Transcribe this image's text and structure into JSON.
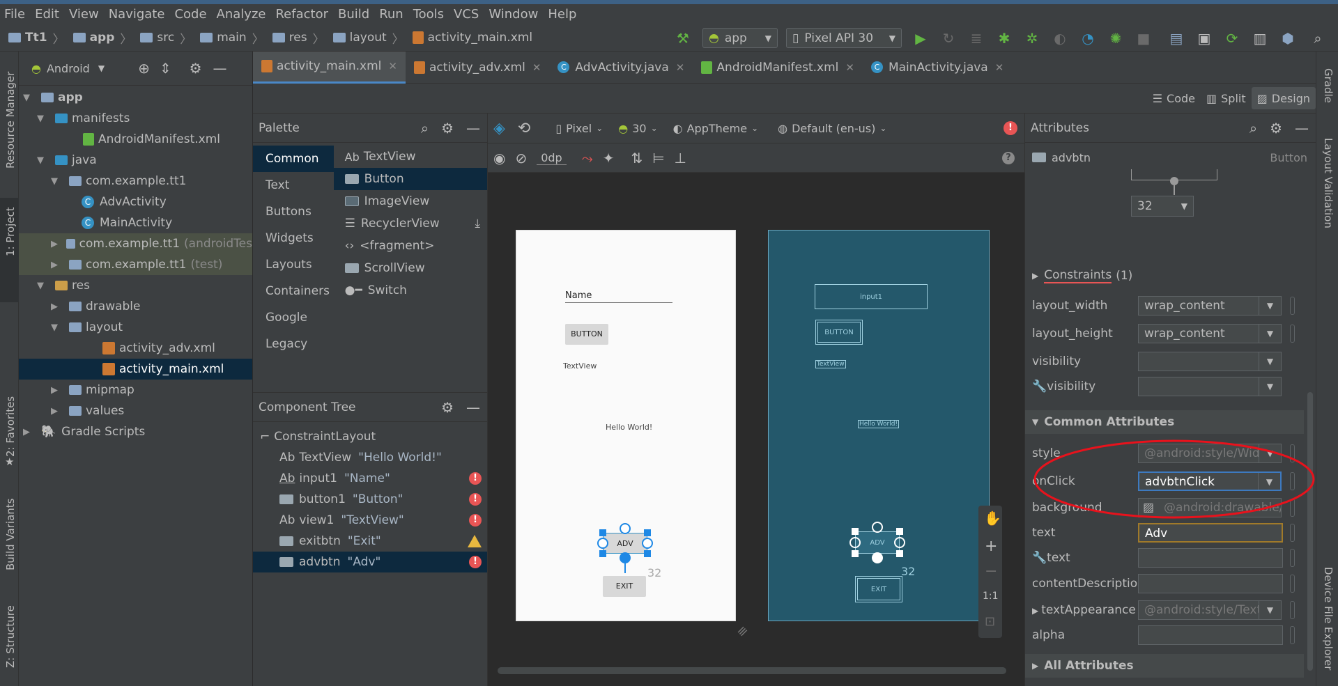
{
  "colors": {
    "accent": "#4a88c7",
    "error": "#e85555",
    "warning": "#e8b83f",
    "blueprint": "#24586b",
    "annotation": "#e8121c"
  },
  "menu": [
    "File",
    "Edit",
    "View",
    "Navigate",
    "Code",
    "Analyze",
    "Refactor",
    "Build",
    "Run",
    "Tools",
    "VCS",
    "Window",
    "Help"
  ],
  "breadcrumb": [
    "Tt1",
    "app",
    "src",
    "main",
    "res",
    "layout",
    "activity_main.xml"
  ],
  "toolbar": {
    "config": "app",
    "device": "Pixel API 30"
  },
  "left_strip": {
    "resource_manager": "Resource Manager",
    "project": "1: Project",
    "favorites": "2: Favorites",
    "build_variants": "Build Variants",
    "structure": "Z: Structure"
  },
  "right_strip": {
    "gradle": "Gradle",
    "layout_validation": "Layout Validation",
    "device_file_explorer": "Device File Explorer"
  },
  "project": {
    "view": "Android",
    "tree": [
      {
        "label": "app",
        "extra": ""
      },
      {
        "label": "manifests",
        "extra": ""
      },
      {
        "label": "AndroidManifest.xml",
        "extra": ""
      },
      {
        "label": "java",
        "extra": ""
      },
      {
        "label": "com.example.tt1",
        "extra": ""
      },
      {
        "label": "AdvActivity",
        "extra": ""
      },
      {
        "label": "MainActivity",
        "extra": ""
      },
      {
        "label": "com.example.tt1",
        "extra": "(androidTes"
      },
      {
        "label": "com.example.tt1",
        "extra": "(test)"
      },
      {
        "label": "res",
        "extra": ""
      },
      {
        "label": "drawable",
        "extra": ""
      },
      {
        "label": "layout",
        "extra": ""
      },
      {
        "label": "activity_adv.xml",
        "extra": ""
      },
      {
        "label": "activity_main.xml",
        "extra": ""
      },
      {
        "label": "mipmap",
        "extra": ""
      },
      {
        "label": "values",
        "extra": ""
      },
      {
        "label": "Gradle Scripts",
        "extra": ""
      }
    ]
  },
  "tabs": [
    "activity_main.xml",
    "activity_adv.xml",
    "AdvActivity.java",
    "AndroidManifest.xml",
    "MainActivity.java"
  ],
  "modes": {
    "code": "Code",
    "split": "Split",
    "design": "Design"
  },
  "palette": {
    "title": "Palette",
    "categories": [
      "Common",
      "Text",
      "Buttons",
      "Widgets",
      "Layouts",
      "Containers",
      "Google",
      "Legacy"
    ],
    "items": [
      "TextView",
      "Button",
      "ImageView",
      "RecyclerView",
      "<fragment>",
      "ScrollView",
      "Switch"
    ],
    "ab": "Ab"
  },
  "component_tree": {
    "title": "Component Tree",
    "root": "ConstraintLayout",
    "rows": [
      {
        "name": "TextView",
        "value": "\"Hello World!\""
      },
      {
        "name": "input1",
        "value": "\"Name\""
      },
      {
        "name": "button1",
        "value": "\"Button\""
      },
      {
        "name": "view1",
        "value": "\"TextView\""
      },
      {
        "name": "exitbtn",
        "value": "\"Exit\""
      },
      {
        "name": "advbtn",
        "value": "\"Adv\""
      }
    ]
  },
  "design_toolbar": {
    "device": "Pixel",
    "api": "30",
    "theme": "AppTheme",
    "locale": "Default (en-us)",
    "margin": "0dp"
  },
  "preview": {
    "name_hint": "Name",
    "button": "BUTTON",
    "textview": "TextView",
    "hello": "Hello World!",
    "adv": "ADV",
    "exit": "EXIT",
    "margin": "32",
    "bp_input": "input1",
    "bp_button": "BUTTON",
    "bp_textview": "TextView",
    "bp_hello": "Hello World!",
    "bp_adv": "ADV",
    "bp_exit": "EXIT",
    "bp_margin": "32"
  },
  "zoom": {
    "one_to_one": "1:1"
  },
  "attributes": {
    "title": "Attributes",
    "component": "advbtn",
    "type": "Button",
    "margin_value": "32",
    "constraints": "Constraints",
    "constraints_count": "(1)",
    "layout_width_label": "layout_width",
    "layout_width": "wrap_content",
    "layout_height_label": "layout_height",
    "layout_height": "wrap_content",
    "visibility_label": "visibility",
    "tools_visibility_label": "visibility",
    "common": "Common Attributes",
    "style_label": "style",
    "style": "@android:style/Widg",
    "onclick_label": "onClick",
    "onclick": "advbtnClick",
    "background_label": "background",
    "background": "@android:drawable/bt",
    "text_label": "text",
    "text": "Adv",
    "tools_text_label": "text",
    "content_desc_label": "contentDescription",
    "text_appearance_label": "textAppearance",
    "text_appearance": "@android:style/Text.",
    "alpha_label": "alpha",
    "all": "All Attributes"
  }
}
